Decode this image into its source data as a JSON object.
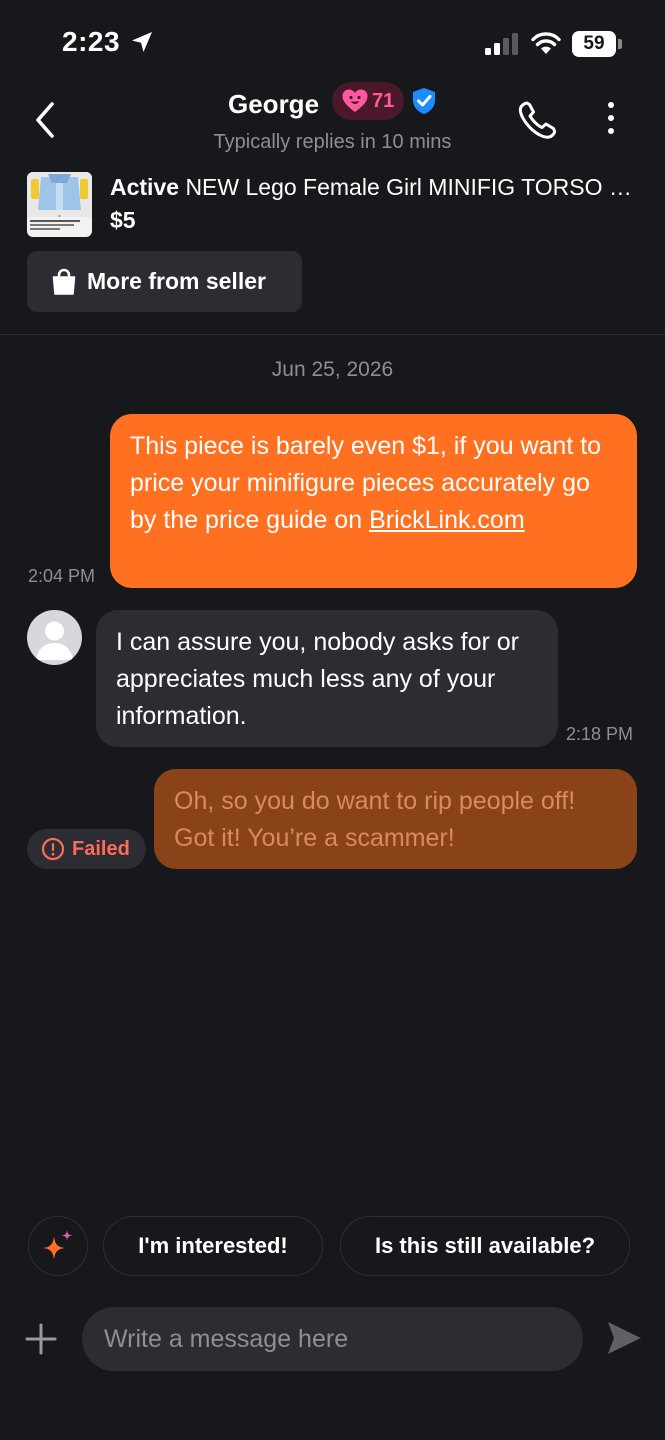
{
  "status_bar": {
    "time": "2:23",
    "battery": "59"
  },
  "header": {
    "seller_name": "George",
    "karma_score": "71",
    "reply_time": "Typically replies in 10 mins",
    "icons": [
      "back-icon",
      "heart-icon",
      "verified-icon",
      "phone-icon",
      "more-icon"
    ]
  },
  "listing": {
    "status": "Active",
    "title": "NEW Lego Female Girl MINIFIG TORSO Light Blue Hoodie Jacket Casual Shirt",
    "price": "$5",
    "thumb_caption": "NEW Lego Female Girl MINIFIG TORSO - Light Blue Hoodie Jacket Casual Shirt"
  },
  "more_from_seller": "More from seller",
  "conversation": {
    "date": "Jun 25, 2026",
    "messages": [
      {
        "direction": "outgoing",
        "text": "This piece is barely even $1, if you want to price your minifigure pieces accurately go by the price guide on ",
        "link": "BrickLink.com",
        "time": "2:04 PM"
      },
      {
        "direction": "incoming",
        "text": "I can assure you, nobody asks for or appreciates much less any of your information.",
        "time": "2:18 PM"
      },
      {
        "direction": "outgoing",
        "text": "Oh, so you do want to rip people off! Got it! You’re a scammer!",
        "status": "Failed"
      }
    ]
  },
  "quick_replies": [
    "I'm interested!",
    "Is this still available?"
  ],
  "composer": {
    "placeholder": "Write a message here"
  },
  "colors": {
    "background": "#17181c",
    "outgoing_bubble": "#ff7020",
    "failed_bubble": "#8a4318",
    "incoming_bubble": "#2c2d32",
    "karma_pink": "#ff5aa0",
    "verified_blue": "#1a8cff",
    "failed_red": "#ff6b5a"
  }
}
